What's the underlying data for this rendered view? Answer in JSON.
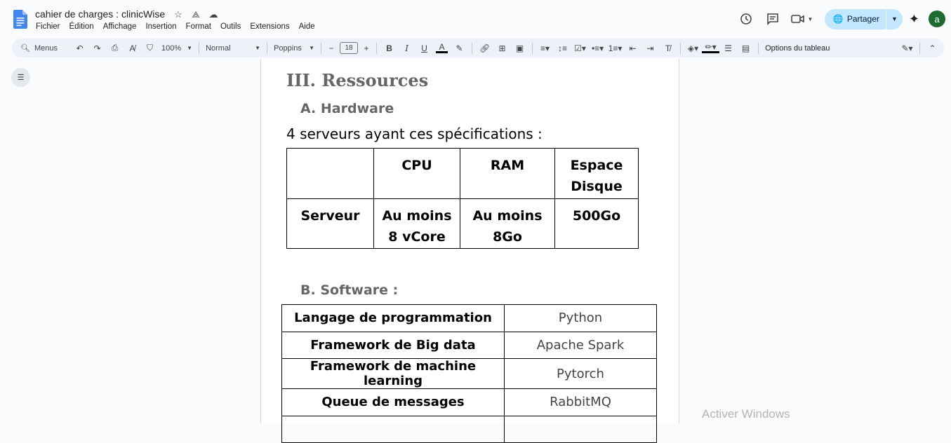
{
  "app": {
    "doc_title": "cahier de charges : clinicWise",
    "menu": [
      "Fichier",
      "Édition",
      "Affichage",
      "Insertion",
      "Format",
      "Outils",
      "Extensions",
      "Aide"
    ],
    "share_label": "Partager",
    "avatar_letter": "a",
    "accent": "#c2e7ff",
    "avatar_color": "#1e6b2f"
  },
  "toolbar": {
    "menus_label": "Menus",
    "zoom": "100%",
    "style": "Normal",
    "font": "Poppins",
    "font_size": "18",
    "table_options": "Options du tableau"
  },
  "doc": {
    "heading1": "III. Ressources",
    "heading_hw": "A. Hardware",
    "hw_intro": "4 serveurs ayant ces spécifications :",
    "spec_table": {
      "headers": [
        "",
        "CPU",
        "RAM",
        "Espace Disque"
      ],
      "row": [
        "Serveur",
        "Au moins 8 vCore",
        "Au moins 8Go",
        "500Go"
      ]
    },
    "heading_sw": "B. Software :",
    "software_table": [
      {
        "key": "Langage de programmation",
        "value": "Python"
      },
      {
        "key": "Framework de Big data",
        "value": "Apache Spark"
      },
      {
        "key": "Framework de machine learning",
        "value": "Pytorch"
      },
      {
        "key": "Queue de messages",
        "value": "RabbitMQ"
      },
      {
        "key": "",
        "value": ""
      }
    ]
  },
  "overlay": {
    "activate_windows": "Activer Windows"
  }
}
